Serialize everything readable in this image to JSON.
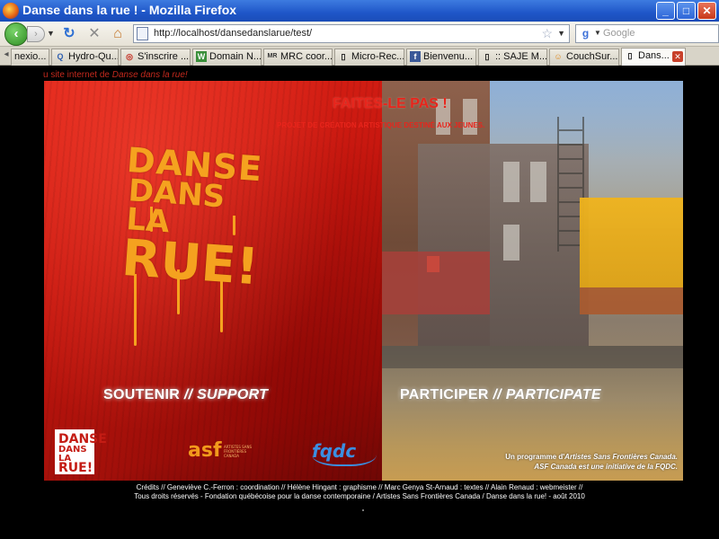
{
  "window": {
    "title": "Danse dans la rue ! - Mozilla Firefox",
    "minimize": "_",
    "maximize": "□",
    "close": "✕"
  },
  "nav": {
    "url": "http://localhost/dansedanslarue/test/",
    "search_placeholder": "Google",
    "search_engine_icon": "google-icon",
    "back_glyph": "‹",
    "forward_glyph": "›"
  },
  "tabs": [
    {
      "label": "nexio...",
      "icon": "page-icon"
    },
    {
      "label": "Hydro-Qu...",
      "icon": "q"
    },
    {
      "label": "S'inscrire ...",
      "icon": "target-icon"
    },
    {
      "label": "Domain N...",
      "icon": "ws"
    },
    {
      "label": "MRC coor...",
      "icon": "mrc"
    },
    {
      "label": "Micro-Rec...",
      "icon": "page-icon"
    },
    {
      "label": "Bienvenu...",
      "icon": "f"
    },
    {
      "label": ":: SAJE M...",
      "icon": "page-icon"
    },
    {
      "label": "CouchSur...",
      "icon": "couch"
    },
    {
      "label": "Dans...",
      "icon": "page-icon",
      "active": true
    }
  ],
  "page": {
    "intro_prefix": "u site internet de ",
    "intro_name": "Danse dans la rue!",
    "graffiti": [
      "DANSE",
      "DANS LA",
      "RUE!"
    ],
    "tagline": "FAITES-LE PAS !",
    "subline": "PROJET DE CRÉATION ARTISTIQUE DESTINÉ AUX JEUNES.",
    "support": {
      "fr": "SOUTENIR",
      "sep": "//",
      "en": "SUPPORT"
    },
    "participate": {
      "fr": "PARTICIPER",
      "sep": "//",
      "en": "PARTICIPATE"
    },
    "logos": {
      "ddlr": [
        "DANSE",
        "DANS LA",
        "RUE!"
      ],
      "asf": "asf",
      "asf_sub": "ARTISTES SANS FRONTIÈRES CANADA",
      "fqdc": "fqdc"
    },
    "program_line1_prefix": "Un programme d'",
    "program_line1_em": "Artistes Sans Frontières Canada.",
    "program_line2": "ASF Canada est une initiative de la FQDC.",
    "credits_line1": "Crédits // Geneviève C.-Ferron : coordination // Hélène Hingant : graphisme // Marc Genya St-Arnaud : textes // Alain Renaud : webmeister //",
    "credits_line2": "Tous droits réservés - Fondation québécoise pour la danse contemporaine / Artistes Sans Frontières Canada / Danse dans la rue! - août 2010"
  },
  "colors": {
    "accent_red": "#e8251c",
    "titlebar_blue": "#1f56c8",
    "graffiti_orange": "#f5a21f"
  }
}
